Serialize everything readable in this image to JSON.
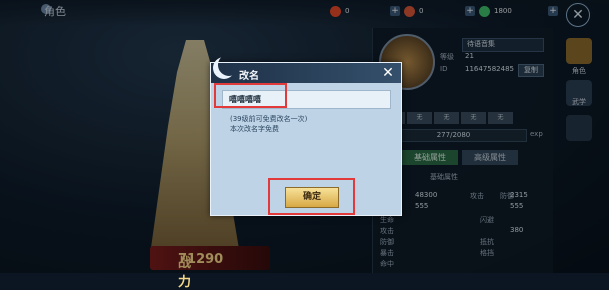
{
  "header": {
    "title": "角色",
    "resources": [
      {
        "icon": "fire-gem-icon",
        "value": "0",
        "color": "#e84a2a"
      },
      {
        "icon": "coin-icon",
        "value": "0",
        "color": "#d9553a"
      },
      {
        "icon": "jade-icon",
        "value": "1800",
        "color": "#3fbf6a"
      }
    ]
  },
  "profile": {
    "name": "待语音集",
    "level_label": "等级",
    "level_value": "21",
    "id_label": "ID",
    "id_value": "11647582485",
    "copy_button": "复制",
    "slots": [
      "无",
      "无",
      "无",
      "无",
      "无"
    ],
    "exp_text": "277/2080",
    "exp_label": "exp",
    "exp_fraction": 0.133,
    "tab_basic": "基础属性",
    "tab_advanced": "高级属性",
    "section_title": "基础属性",
    "stats_right": [
      "48300",
      "2315",
      "555",
      "555",
      "380"
    ],
    "stat_labels_right": [
      "攻击",
      "防御",
      "暴击",
      "暴击伤害",
      "命中"
    ],
    "stat_labels_left": [
      "生命",
      "攻击",
      "防御",
      "暴击",
      "命中",
      "闪避",
      "抵抗",
      "格挡"
    ]
  },
  "side_nav": {
    "role": "角色",
    "martial": "武学"
  },
  "power": {
    "label": "战力",
    "value": "71290"
  },
  "rename_dialog": {
    "title": "改名",
    "input_value": "嘻嘻嘻嘻",
    "note_line1": "(39级前可免费改名一次)",
    "note_line2": "本次改名字免费",
    "confirm_label": "确定"
  },
  "colors": {
    "highlight": "#e23a3a",
    "dialog_bg": "#bfd3e6",
    "button_gold": "#d7a845"
  }
}
